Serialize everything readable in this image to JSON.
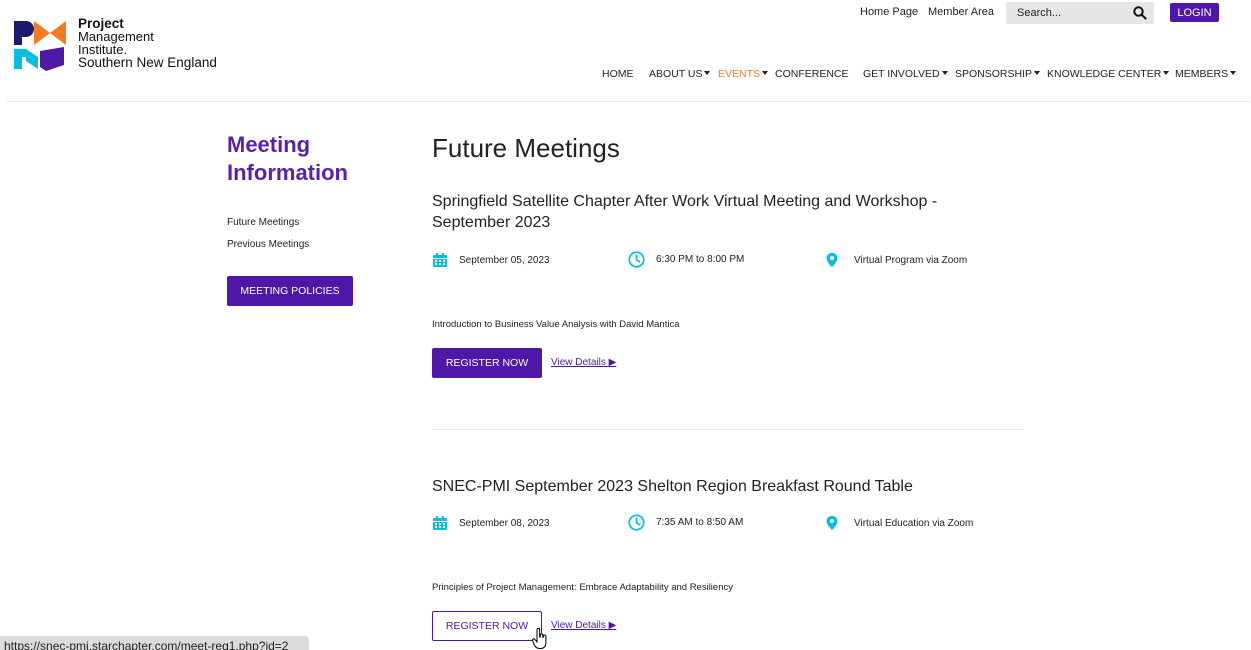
{
  "logo": {
    "line1": "Project",
    "line2": "Management",
    "line3": "Institute.",
    "line4": "Southern New England",
    "colors": [
      "#f47b20",
      "#1a1a6e",
      "#05bfe0",
      "#4f17a8"
    ]
  },
  "top_links": {
    "home": "Home Page",
    "member": "Member Area"
  },
  "search": {
    "placeholder": "Search...",
    "icon": "search-icon"
  },
  "login_label": "LOGIN",
  "nav": [
    {
      "label": "HOME",
      "dropdown": false
    },
    {
      "label": "ABOUT US",
      "dropdown": true
    },
    {
      "label": "EVENTS",
      "dropdown": true,
      "active": true
    },
    {
      "label": "CONFERENCE",
      "dropdown": false
    },
    {
      "label": "GET INVOLVED",
      "dropdown": true
    },
    {
      "label": "SPONSORSHIP",
      "dropdown": true
    },
    {
      "label": "KNOWLEDGE CENTER",
      "dropdown": true
    },
    {
      "label": "MEMBERS",
      "dropdown": true
    }
  ],
  "sidebar": {
    "title": "Meeting Information",
    "links": [
      "Future Meetings",
      "Previous Meetings"
    ],
    "button": "MEETING POLICIES"
  },
  "main": {
    "title": "Future Meetings",
    "events": [
      {
        "title": "Springfield Satellite Chapter After Work Virtual Meeting and Workshop - September 2023",
        "date": "September 05, 2023",
        "time": "6:30 PM to 8:00 PM",
        "location": "Virtual Program via Zoom",
        "description": "Introduction to Business Value Analysis with David Mantica",
        "register": "REGISTER NOW",
        "details": "View Details ▶"
      },
      {
        "title": "SNEC-PMI September 2023 Shelton Region Breakfast Round Table",
        "date": "September 08, 2023",
        "time": "7:35 AM to 8:50 AM",
        "location": "Virtual Education via Zoom",
        "description": "Principles of Project Management: Embrace Adaptability and Resiliency",
        "register": "REGISTER NOW",
        "details": "View Details ▶"
      }
    ]
  },
  "status_url": "https://snec-pmi.starchapter.com/meet-reg1.php?id=2",
  "accent": "#4f17a8",
  "icon_accent": "#05bfe0",
  "nav_active_color": "#f47b20"
}
